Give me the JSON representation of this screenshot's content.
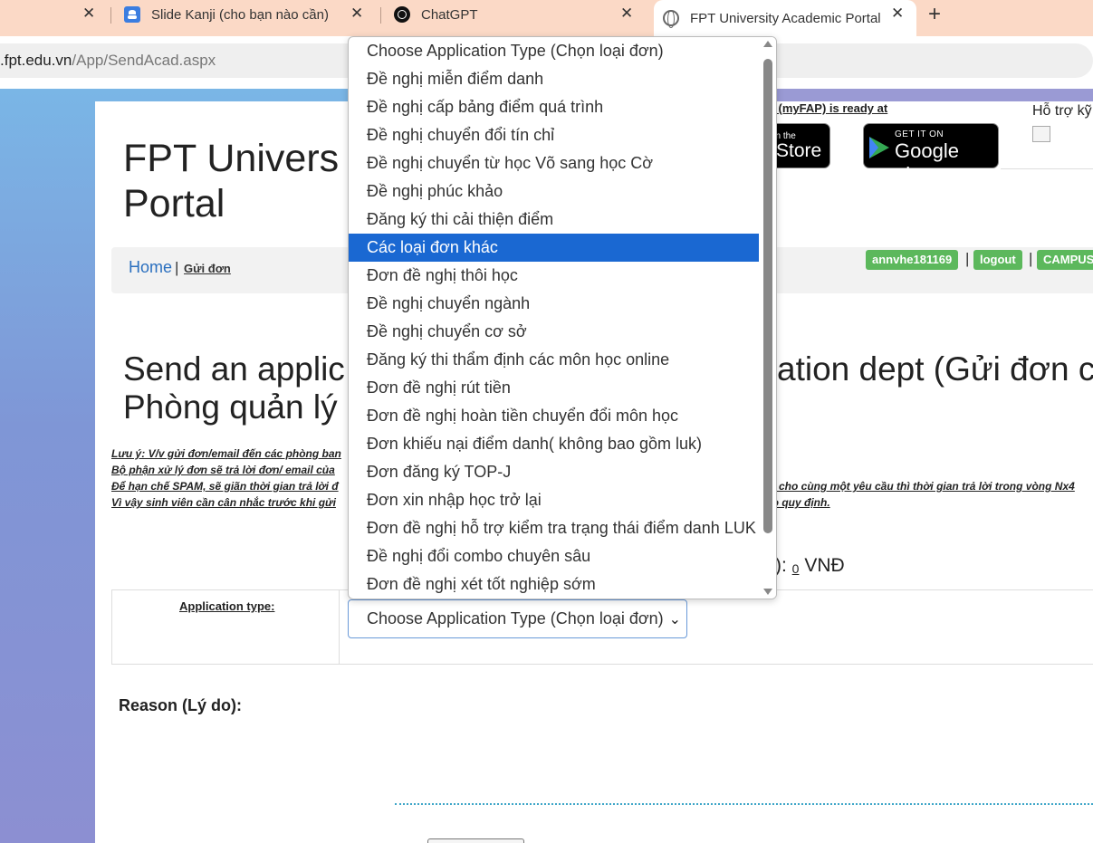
{
  "browser": {
    "tabs": [
      {
        "title": "",
        "favicon": "none",
        "active": false
      },
      {
        "title": "Slide Kanji (cho bạn nào cần)",
        "favicon": "google-slides-icon",
        "active": false
      },
      {
        "title": "ChatGPT",
        "favicon": "chatgpt-icon",
        "active": false
      },
      {
        "title": "FPT University Academic Portal",
        "favicon": "globe-icon",
        "active": true
      }
    ],
    "url_host": ".fpt.edu.vn",
    "url_path": "/App/SendAcad.aspx",
    "close_glyph": "✕",
    "new_tab_glyph": "+"
  },
  "header": {
    "site_title": "FPT University Academic Portal",
    "site_title_visible": "FPT Univers",
    "site_title_line2": "Portal",
    "myfap_text": "p (myFAP) is ready at",
    "support_text": "Hỗ trợ kỹ",
    "app_store": {
      "small": "on the",
      "big": "Store"
    },
    "google_play": {
      "small": "GET IT ON",
      "big": "Google play"
    }
  },
  "nav": {
    "home": "Home",
    "separator": "|",
    "current": "Gửi đơn",
    "username": "annvhe181169",
    "logout": "logout",
    "campus": "CAMPUS"
  },
  "main": {
    "heading_line1_left": "Send an applic",
    "heading_line1_right": "ation dept (Gửi đơn ch",
    "heading_line2_left": "Phòng quản lý",
    "notes": [
      {
        "left": "Lưu ý: V/v gửi đơn/email đến các phòng ban",
        "right": ""
      },
      {
        "left": "Bộ phận xử lý đơn sẽ trả lời đơn/ email của",
        "right": ""
      },
      {
        "left": "Để hạn chế SPAM, sẽ giãn thời gian trả lời đ",
        "right": "1) cho cùng một yêu cầu thì thời gian trả lời trong vòng Nx4"
      },
      {
        "left": "Vì vậy sinh viên cần cân nhắc trước khi gửi",
        "right": "eo quy định."
      }
    ],
    "fee_prefix": "):",
    "fee_value": "0",
    "fee_unit": "VNĐ",
    "application_type_label": "Application type:",
    "select_value": "Choose Application Type (Chọn loại đơn)",
    "reason_label": "Reason (Lý do):"
  },
  "dropdown": {
    "selected_index": 7,
    "options": [
      "Choose Application Type (Chọn loại đơn)",
      "Đề nghị miễn điểm danh",
      "Đề nghị cấp bảng điểm quá trình",
      "Đề nghị chuyển đổi tín chỉ",
      "Đề nghị chuyển từ học Võ sang học Cờ",
      "Đề nghị phúc khảo",
      "Đăng ký thi cải thiện điểm",
      "Các loại đơn khác",
      "Đơn đề nghị thôi học",
      "Đề nghị chuyển ngành",
      "Đề nghị chuyển cơ sở",
      "Đăng ký thi thẩm định các môn học online",
      "Đơn đề nghị rút tiền",
      "Đơn đề nghị hoàn tiền chuyển đổi môn học",
      "Đơn khiếu nại điểm danh( không bao gồm luk)",
      "Đơn đăng ký TOP-J",
      "Đơn xin nhập học trở lại",
      "Đơn đề nghị hỗ trợ kiểm tra trạng thái điểm danh LUK",
      "Đề nghị đổi combo chuyên sâu",
      "Đơn đề nghị xét tốt nghiệp sớm"
    ]
  },
  "colors": {
    "tabbar": "#fbd9c6",
    "link": "#2a6fbf",
    "pill": "#5cb85c",
    "selected_option": "#1a68d2"
  }
}
